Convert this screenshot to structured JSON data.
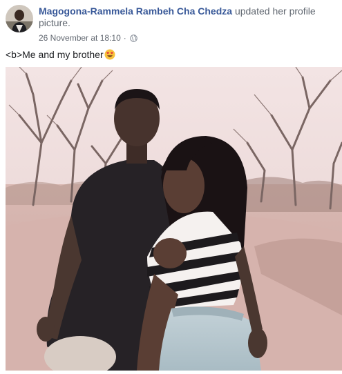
{
  "post": {
    "author": "Magogona-Rammela Rambeh Cha Chedza",
    "action": "updated her profile picture.",
    "timestamp": "26 November at 18:10",
    "separator": "·",
    "privacy_icon": "globe-icon",
    "caption": "<b>Me and my brother",
    "caption_emoji": "heart-eyes-emoji",
    "photo": "profile-picture-photo"
  },
  "colors": {
    "author_link": "#385898",
    "secondary_text": "#616770",
    "body_text": "#1c1e21"
  }
}
